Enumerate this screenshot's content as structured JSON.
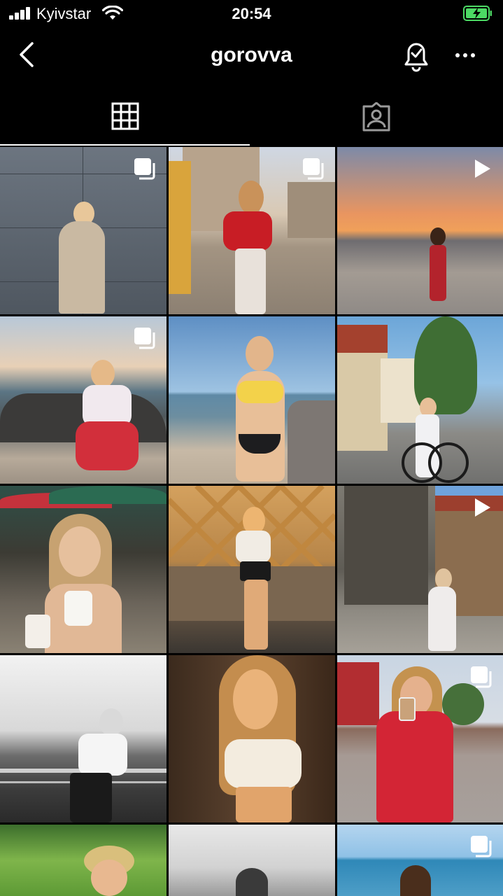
{
  "status": {
    "carrier": "Kyivstar",
    "time": "20:54"
  },
  "header": {
    "username": "gorovva"
  },
  "icons": {
    "back": "chevron-left-icon",
    "bell": "notification-bell-icon",
    "more": "more-options-icon",
    "grid": "grid-icon",
    "tagged": "tagged-person-icon",
    "multi": "multiple-photos-icon",
    "video": "video-play-icon"
  },
  "posts": [
    {
      "kind": "multi",
      "scene": "woman in beige sweater against grey wall"
    },
    {
      "kind": "multi",
      "scene": "woman in red top on city square"
    },
    {
      "kind": "video",
      "scene": "woman on beach at sunset"
    },
    {
      "kind": "multi",
      "scene": "woman sitting on rocks by sea"
    },
    {
      "kind": "none",
      "scene": "woman in yellow bikini on beach"
    },
    {
      "kind": "none",
      "scene": "woman with bicycle in front of houses"
    },
    {
      "kind": "none",
      "scene": "woman with coffee at cafe terrace"
    },
    {
      "kind": "none",
      "scene": "woman by wooden lattice fence"
    },
    {
      "kind": "video",
      "scene": "woman in white dress in old town"
    },
    {
      "kind": "none",
      "scene": "black and white photo by highway railing"
    },
    {
      "kind": "none",
      "scene": "woman in white top in warm light"
    },
    {
      "kind": "multi",
      "scene": "woman in red polka dot outfit holding drink"
    },
    {
      "kind": "none",
      "scene": "woman in straw hat in green field"
    },
    {
      "kind": "none",
      "scene": "black and white portrait"
    },
    {
      "kind": "multi",
      "scene": "woman by the sea"
    }
  ]
}
